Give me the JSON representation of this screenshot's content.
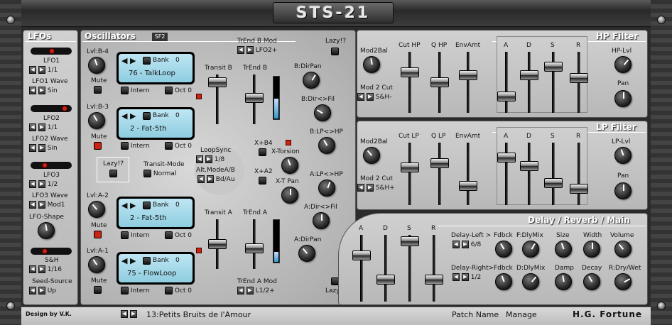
{
  "app": {
    "logo": "STS-21",
    "designer": "Design by V.K.",
    "brand": "H.G. Fortune"
  },
  "lfo": {
    "title": "LFOs",
    "lfo1": {
      "label": "LFO1",
      "rate": "1/1",
      "wave_label": "LFO1 Wave",
      "wave": "Sin"
    },
    "lfo2": {
      "label": "LFO2",
      "rate": "1/1",
      "wave_label": "LFO2 Wave",
      "wave": "Sin"
    },
    "lfo3": {
      "label": "LFO3",
      "rate": "1/2",
      "wave_label": "LFO3 Wave",
      "wave": "Mod1"
    },
    "shape_label": "LFO-Shape",
    "sh": {
      "label": "S&H",
      "rate": "1/16",
      "seed_label": "Seed-Source",
      "seed": "Up"
    }
  },
  "osc": {
    "title": "Oscillators",
    "tag": "SF2",
    "b4": {
      "lvl": "Lvl:B-4",
      "mute": "Mute",
      "bank": "Bank",
      "bank_num": "0",
      "patch": "76 - TalkLoop",
      "intern": "Intern",
      "oct": "Oct 0"
    },
    "b3": {
      "lvl": "Lvl:B-3",
      "mute": "Mute",
      "bank": "Bank",
      "bank_num": "0",
      "patch": "2 - Fat-5th",
      "intern": "Intern",
      "oct": "Oct 0"
    },
    "a2": {
      "lvl": "Lvl:A-2",
      "mute": "Mute",
      "bank": "Bank",
      "bank_num": "0",
      "patch": "2 - Fat-5th",
      "intern": "Intern",
      "oct": "Oct 0"
    },
    "a1": {
      "lvl": "Lvl:A-1",
      "mute": "Mute",
      "bank": "Bank",
      "bank_num": "0",
      "patch": "75 - FlowLoop",
      "intern": "Intern",
      "oct": "Oct 0"
    },
    "lazy": "Lazy!?",
    "transit_mode_label": "Transit-Mode",
    "transit_mode": "Normal",
    "loopsync_label": "LoopSync",
    "loopsync": "1/8",
    "altmode_label": "Alt.ModeA/B",
    "altmode": "Bd/Au",
    "transit_b": "Transit B",
    "trend_b": "TrEnd B",
    "trend_b_mod": "TrEnd B Mod",
    "trend_b_mod_val": "LFO2+",
    "transit_a": "Transit A",
    "trend_a": "TrEnd A",
    "trend_a_mod": "TrEnd A Mod",
    "trend_a_mod_val": "L1/2+",
    "b_dirpan": "B:DirPan",
    "b_dirfil": "B:Dir<>Fil",
    "b_lphp": "B:LP<>HP",
    "xb4": "X+B4",
    "xtorsion": "X-Torsion",
    "xa2": "X+A2",
    "xtpan": "X-T Pan",
    "a_lphp": "A:LP<>HP",
    "a_dirfil": "A:Dir<>Fil",
    "a_dirpan": "A:DirPan",
    "lazy_top": "Lazy!?",
    "lazy_bottom": "Lazy!?"
  },
  "hp": {
    "title": "HP Filter",
    "mod2bal": "Mod2Bal",
    "mod2cut": "Mod 2 Cut",
    "mod2cut_val": "S&H-",
    "cut": "Cut HP",
    "q": "Q HP",
    "env": "EnvAmt",
    "a": "A",
    "d": "D",
    "s": "S",
    "r": "R",
    "lvl": "HP-Lvl",
    "pan": "Pan"
  },
  "lp": {
    "title": "LP Filter",
    "mod2bal": "Mod2Bal",
    "mod2cut": "Mod 2 Cut",
    "mod2cut_val": "S&H+",
    "cut": "Cut LP",
    "q": "Q LP",
    "env": "EnvAmt",
    "a": "A",
    "d": "D",
    "s": "S",
    "r": "R",
    "lvl": "LP-Lvl",
    "pan": "Pan"
  },
  "fx": {
    "title": "Delay / Reverb / Main",
    "a": "A",
    "d": "D",
    "s": "S",
    "r": "R",
    "delay_left": "Delay-Left >",
    "delay_left_val": "6/8",
    "delay_right": "Delay-Right>",
    "delay_right_val": "1/2",
    "fdbck1": "Fdbck",
    "fdlymix": "F:DlyMix",
    "size": "Size",
    "width": "Width",
    "volume": "Volume",
    "fdbck2": "Fdbck",
    "ddlymix": "D:DlyMix",
    "damp": "Damp",
    "decay": "Decay",
    "rdrywet": "R:Dry/Wet"
  },
  "footer": {
    "patch": "13:Petits Bruits de l'Amour",
    "patch_name": "Patch Name",
    "manage": "Manage"
  },
  "icons": {
    "arrow_left": "◀",
    "arrow_right": "▶",
    "bank_left": "◀",
    "bank_right": "▶"
  }
}
